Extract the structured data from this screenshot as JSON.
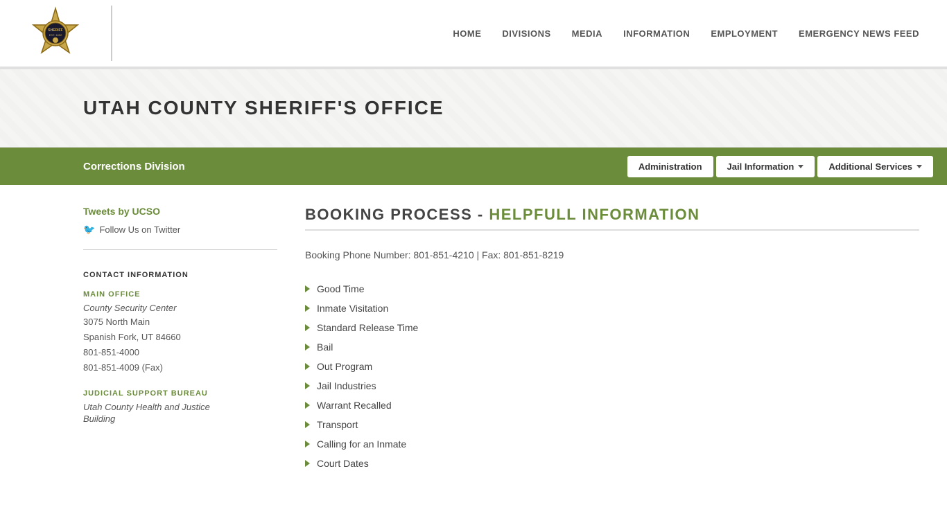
{
  "header": {
    "nav_items": [
      "HOME",
      "DIVISIONS",
      "MEDIA",
      "INFORMATION",
      "EMPLOYMENT",
      "EMERGENCY NEWS FEED"
    ]
  },
  "hero": {
    "title": "UTAH COUNTY SHERIFF'S OFFICE"
  },
  "green_nav": {
    "title": "Corrections Division",
    "items": [
      {
        "label": "Administration",
        "has_dropdown": false
      },
      {
        "label": "Jail Information",
        "has_dropdown": true
      },
      {
        "label": "Additional Services",
        "has_dropdown": true
      }
    ]
  },
  "sidebar": {
    "tweets_label": "Tweets by UCSO",
    "follow_label": "Follow Us on Twitter",
    "contact_title": "CONTACT INFORMATION",
    "main_office": {
      "heading": "MAIN OFFICE",
      "building": "County Security Center",
      "address1": "3075 North Main",
      "address2": "Spanish Fork, UT 84660",
      "phone1": "801-851-4000",
      "phone2": "801-851-4009 (Fax)"
    },
    "judicial_bureau": {
      "heading": "JUDICIAL SUPPORT BUREAU",
      "building": "Utah County Health and Justice",
      "building2": "Building"
    }
  },
  "article": {
    "title_prefix": "BOOKING PROCESS - ",
    "title_highlight": "HELPFULL INFORMATION",
    "booking_info": "Booking Phone Number: 801-851-4210 | Fax: 801-851-8219",
    "list_items": [
      "Good Time",
      "Inmate Visitation",
      "Standard Release Time",
      "Bail",
      "Out Program",
      "Jail Industries",
      "Warrant Recalled",
      "Transport",
      "Calling for an Inmate",
      "Court Dates"
    ]
  }
}
